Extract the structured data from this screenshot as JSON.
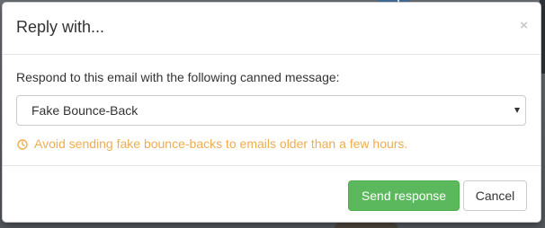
{
  "modal": {
    "title": "Reply with...",
    "close_glyph": "×",
    "instruction": "Respond to this email with the following canned message:",
    "select": {
      "value": "Fake Bounce-Back"
    },
    "warning": {
      "icon": "clock-icon",
      "text": "Avoid sending fake bounce-backs to emails older than a few hours.",
      "color": "#f0ad4e"
    },
    "buttons": {
      "send_label": "Send response",
      "cancel_label": "Cancel"
    }
  },
  "colors": {
    "primary_button": "#5cb85c",
    "warning": "#f0ad4e",
    "text": "#333333"
  }
}
